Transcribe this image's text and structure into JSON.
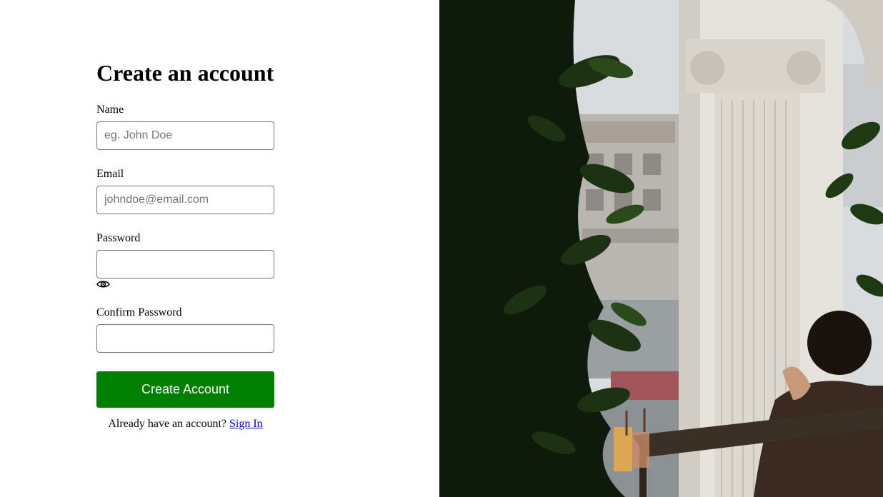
{
  "form": {
    "title": "Create an account",
    "name_label": "Name",
    "name_placeholder": "eg. John Doe",
    "name_value": "",
    "email_label": "Email",
    "email_placeholder": "johndoe@email.com",
    "email_value": "",
    "password_label": "Password",
    "password_value": "",
    "password_toggle_icon": "eye-icon",
    "confirm_label": "Confirm Password",
    "confirm_value": "",
    "submit_label": "Create Account",
    "signin_prompt": "Already have an account?",
    "signin_link": "Sign In"
  },
  "colors": {
    "primary_button": "#008000",
    "link": "#0000ee"
  }
}
